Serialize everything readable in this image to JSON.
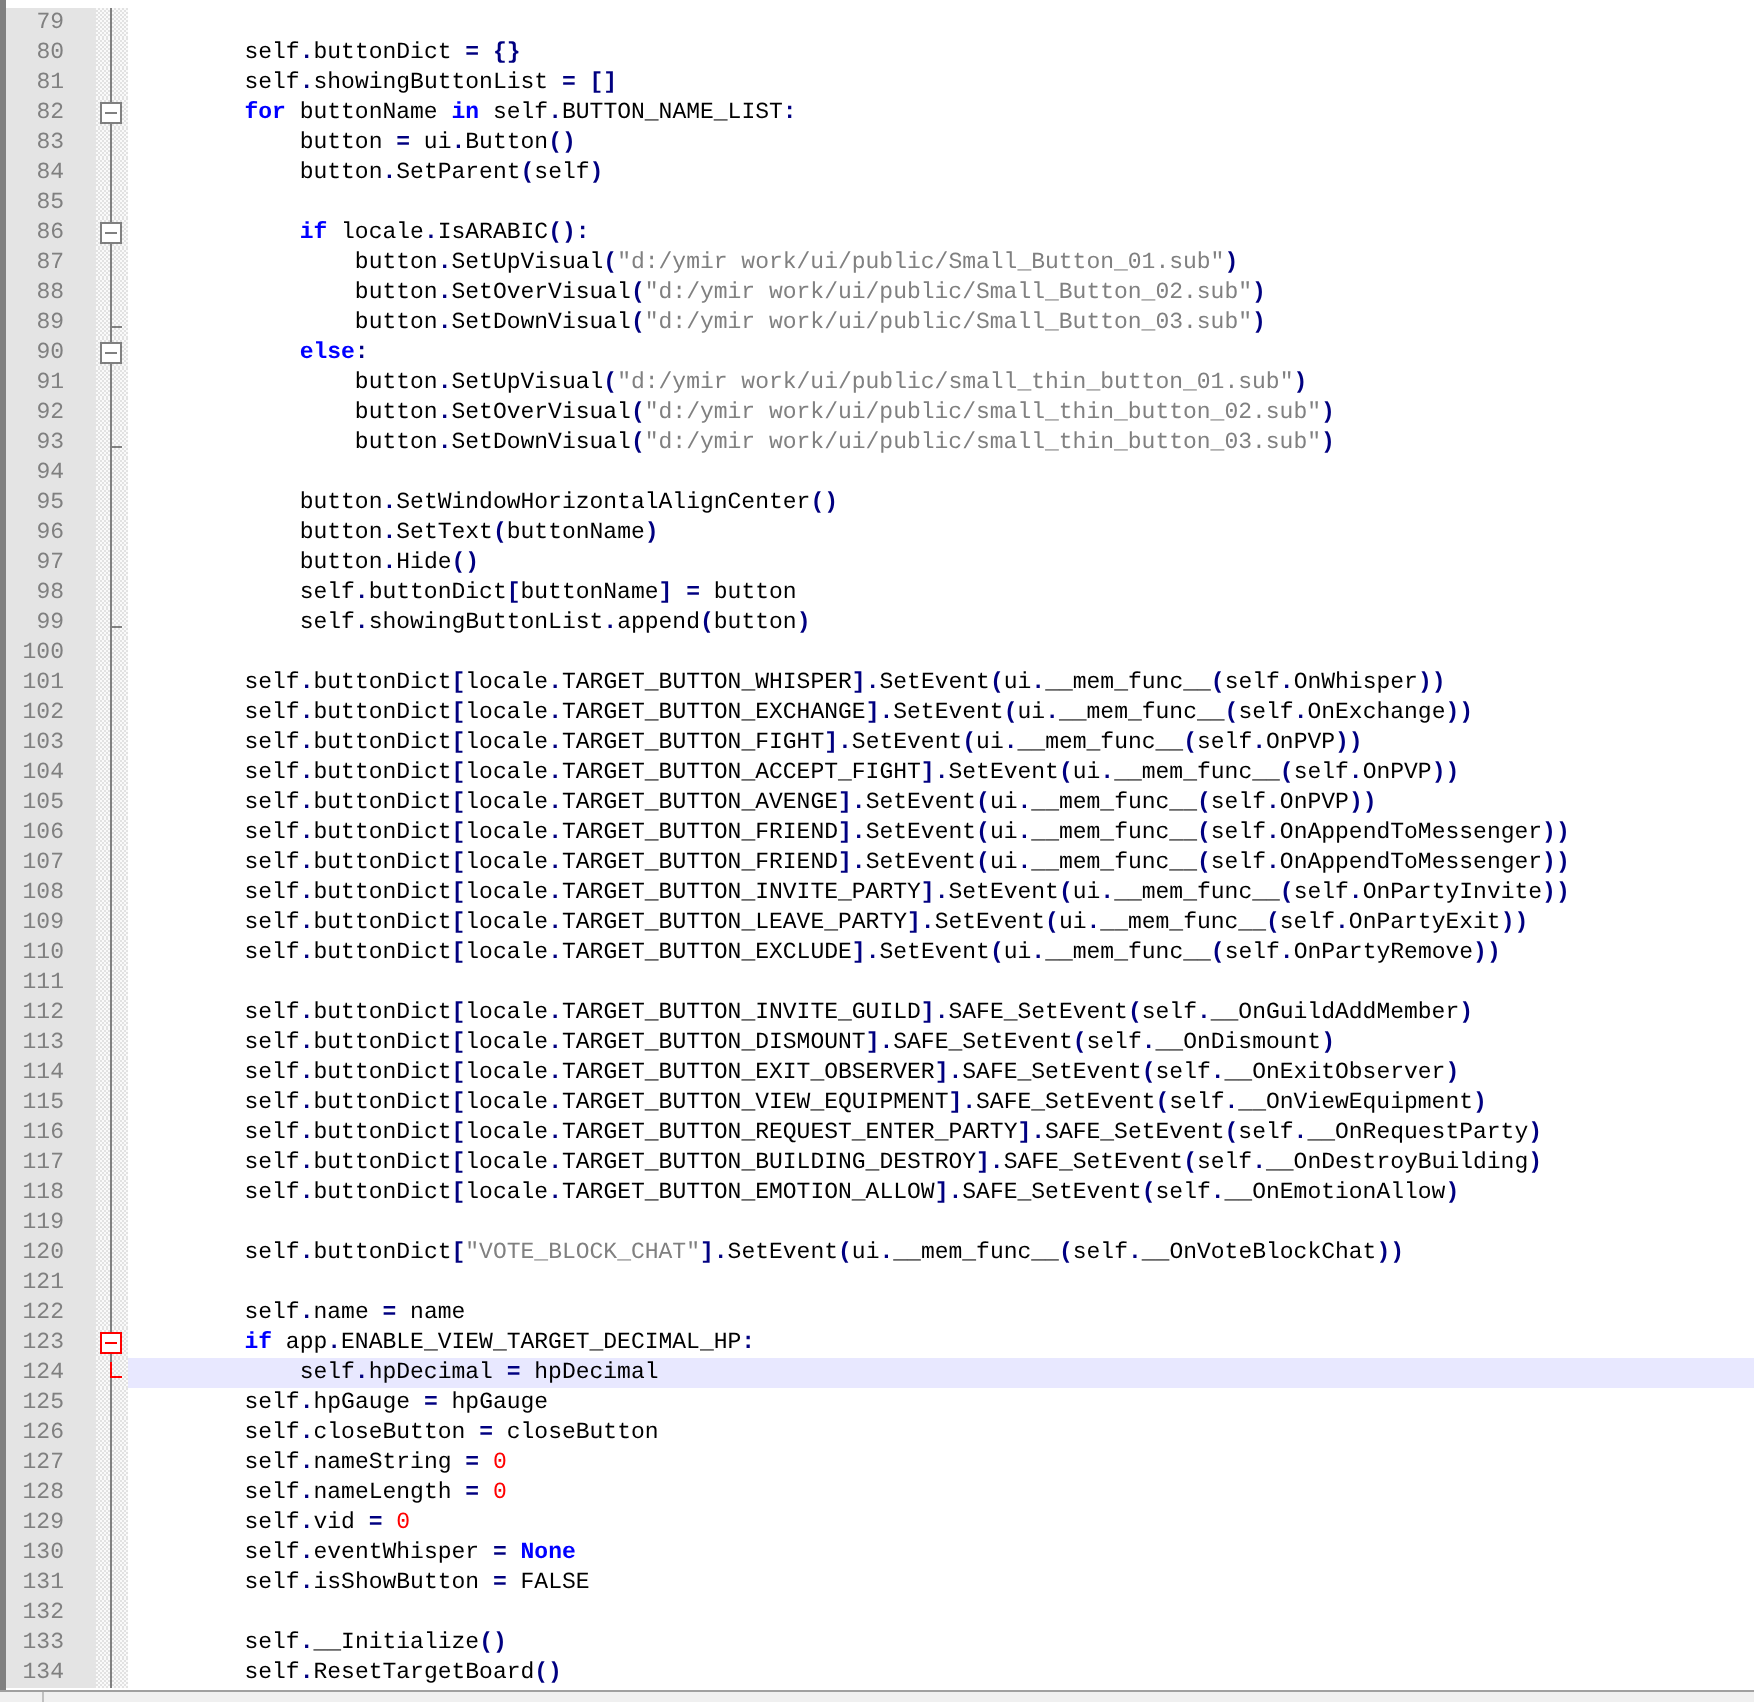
{
  "lines": [
    {
      "number": "79"
    },
    {
      "number": "80",
      "tokens": [
        {
          "text": "        self",
          "kind": "id"
        },
        {
          "text": ".",
          "kind": "op"
        },
        {
          "text": "buttonDict ",
          "kind": "id"
        },
        {
          "text": "= {}",
          "kind": "op"
        }
      ]
    },
    {
      "number": "81",
      "tokens": [
        {
          "text": "        self",
          "kind": "id"
        },
        {
          "text": ".",
          "kind": "op"
        },
        {
          "text": "showingButtonList ",
          "kind": "id"
        },
        {
          "text": "= []",
          "kind": "op"
        }
      ]
    },
    {
      "number": "82",
      "fold": {
        "kind": "start",
        "expanded": true,
        "active": false
      },
      "tokens": [
        {
          "text": "        for",
          "kind": "kw"
        },
        {
          "text": " buttonName ",
          "kind": "id"
        },
        {
          "text": "in",
          "kind": "kw"
        },
        {
          "text": " self",
          "kind": "id"
        },
        {
          "text": ".",
          "kind": "op"
        },
        {
          "text": "BUTTON_NAME_LIST",
          "kind": "id"
        },
        {
          "text": ":",
          "kind": "op"
        }
      ]
    },
    {
      "number": "83",
      "tokens": [
        {
          "text": "            button ",
          "kind": "id"
        },
        {
          "text": "=",
          "kind": "op"
        },
        {
          "text": " ui",
          "kind": "id"
        },
        {
          "text": ".",
          "kind": "op"
        },
        {
          "text": "Button",
          "kind": "id"
        },
        {
          "text": "()",
          "kind": "op"
        }
      ]
    },
    {
      "number": "84",
      "tokens": [
        {
          "text": "            button",
          "kind": "id"
        },
        {
          "text": ".",
          "kind": "op"
        },
        {
          "text": "SetParent",
          "kind": "id"
        },
        {
          "text": "(",
          "kind": "op"
        },
        {
          "text": "self",
          "kind": "id"
        },
        {
          "text": ")",
          "kind": "op"
        }
      ]
    },
    {
      "number": "85"
    },
    {
      "number": "86",
      "fold": {
        "kind": "start",
        "expanded": true,
        "active": false
      },
      "tokens": [
        {
          "text": "            if",
          "kind": "kw"
        },
        {
          "text": " locale",
          "kind": "id"
        },
        {
          "text": ".",
          "kind": "op"
        },
        {
          "text": "IsARABIC",
          "kind": "id"
        },
        {
          "text": "():",
          "kind": "op"
        }
      ]
    },
    {
      "number": "87",
      "tokens": [
        {
          "text": "                button",
          "kind": "id"
        },
        {
          "text": ".",
          "kind": "op"
        },
        {
          "text": "SetUpVisual",
          "kind": "id"
        },
        {
          "text": "(",
          "kind": "op"
        },
        {
          "text": "\"d:/ymir work/ui/public/Small_Button_01.sub\"",
          "kind": "str"
        },
        {
          "text": ")",
          "kind": "op"
        }
      ]
    },
    {
      "number": "88",
      "tokens": [
        {
          "text": "                button",
          "kind": "id"
        },
        {
          "text": ".",
          "kind": "op"
        },
        {
          "text": "SetOverVisual",
          "kind": "id"
        },
        {
          "text": "(",
          "kind": "op"
        },
        {
          "text": "\"d:/ymir work/ui/public/Small_Button_02.sub\"",
          "kind": "str"
        },
        {
          "text": ")",
          "kind": "op"
        }
      ]
    },
    {
      "number": "89",
      "fold": {
        "kind": "end",
        "active": false
      },
      "tokens": [
        {
          "text": "                button",
          "kind": "id"
        },
        {
          "text": ".",
          "kind": "op"
        },
        {
          "text": "SetDownVisual",
          "kind": "id"
        },
        {
          "text": "(",
          "kind": "op"
        },
        {
          "text": "\"d:/ymir work/ui/public/Small_Button_03.sub\"",
          "kind": "str"
        },
        {
          "text": ")",
          "kind": "op"
        }
      ]
    },
    {
      "number": "90",
      "fold": {
        "kind": "start",
        "expanded": true,
        "active": false
      },
      "tokens": [
        {
          "text": "            else",
          "kind": "kw"
        },
        {
          "text": ":",
          "kind": "op"
        }
      ]
    },
    {
      "number": "91",
      "tokens": [
        {
          "text": "                button",
          "kind": "id"
        },
        {
          "text": ".",
          "kind": "op"
        },
        {
          "text": "SetUpVisual",
          "kind": "id"
        },
        {
          "text": "(",
          "kind": "op"
        },
        {
          "text": "\"d:/ymir work/ui/public/small_thin_button_01.sub\"",
          "kind": "str"
        },
        {
          "text": ")",
          "kind": "op"
        }
      ]
    },
    {
      "number": "92",
      "tokens": [
        {
          "text": "                button",
          "kind": "id"
        },
        {
          "text": ".",
          "kind": "op"
        },
        {
          "text": "SetOverVisual",
          "kind": "id"
        },
        {
          "text": "(",
          "kind": "op"
        },
        {
          "text": "\"d:/ymir work/ui/public/small_thin_button_02.sub\"",
          "kind": "str"
        },
        {
          "text": ")",
          "kind": "op"
        }
      ]
    },
    {
      "number": "93",
      "fold": {
        "kind": "end",
        "active": false
      },
      "tokens": [
        {
          "text": "                button",
          "kind": "id"
        },
        {
          "text": ".",
          "kind": "op"
        },
        {
          "text": "SetDownVisual",
          "kind": "id"
        },
        {
          "text": "(",
          "kind": "op"
        },
        {
          "text": "\"d:/ymir work/ui/public/small_thin_button_03.sub\"",
          "kind": "str"
        },
        {
          "text": ")",
          "kind": "op"
        }
      ]
    },
    {
      "number": "94"
    },
    {
      "number": "95",
      "tokens": [
        {
          "text": "            button",
          "kind": "id"
        },
        {
          "text": ".",
          "kind": "op"
        },
        {
          "text": "SetWindowHorizontalAlignCenter",
          "kind": "id"
        },
        {
          "text": "()",
          "kind": "op"
        }
      ]
    },
    {
      "number": "96",
      "tokens": [
        {
          "text": "            button",
          "kind": "id"
        },
        {
          "text": ".",
          "kind": "op"
        },
        {
          "text": "SetText",
          "kind": "id"
        },
        {
          "text": "(",
          "kind": "op"
        },
        {
          "text": "buttonName",
          "kind": "id"
        },
        {
          "text": ")",
          "kind": "op"
        }
      ]
    },
    {
      "number": "97",
      "tokens": [
        {
          "text": "            button",
          "kind": "id"
        },
        {
          "text": ".",
          "kind": "op"
        },
        {
          "text": "Hide",
          "kind": "id"
        },
        {
          "text": "()",
          "kind": "op"
        }
      ]
    },
    {
      "number": "98",
      "tokens": [
        {
          "text": "            self",
          "kind": "id"
        },
        {
          "text": ".",
          "kind": "op"
        },
        {
          "text": "buttonDict",
          "kind": "id"
        },
        {
          "text": "[",
          "kind": "op"
        },
        {
          "text": "buttonName",
          "kind": "id"
        },
        {
          "text": "] =",
          "kind": "op"
        },
        {
          "text": " button",
          "kind": "id"
        }
      ]
    },
    {
      "number": "99",
      "fold": {
        "kind": "end",
        "active": false
      },
      "tokens": [
        {
          "text": "            self",
          "kind": "id"
        },
        {
          "text": ".",
          "kind": "op"
        },
        {
          "text": "showingButtonList",
          "kind": "id"
        },
        {
          "text": ".",
          "kind": "op"
        },
        {
          "text": "append",
          "kind": "id"
        },
        {
          "text": "(",
          "kind": "op"
        },
        {
          "text": "button",
          "kind": "id"
        },
        {
          "text": ")",
          "kind": "op"
        }
      ]
    },
    {
      "number": "100"
    },
    {
      "number": "101",
      "tokens": [
        {
          "text": "        self",
          "kind": "id"
        },
        {
          "text": ".",
          "kind": "op"
        },
        {
          "text": "buttonDict",
          "kind": "id"
        },
        {
          "text": "[",
          "kind": "op"
        },
        {
          "text": "locale",
          "kind": "id"
        },
        {
          "text": ".",
          "kind": "op"
        },
        {
          "text": "TARGET_BUTTON_WHISPER",
          "kind": "id"
        },
        {
          "text": "].",
          "kind": "op"
        },
        {
          "text": "SetEvent",
          "kind": "id"
        },
        {
          "text": "(",
          "kind": "op"
        },
        {
          "text": "ui",
          "kind": "id"
        },
        {
          "text": ".",
          "kind": "op"
        },
        {
          "text": "__mem_func__",
          "kind": "id"
        },
        {
          "text": "(",
          "kind": "op"
        },
        {
          "text": "self",
          "kind": "id"
        },
        {
          "text": ".",
          "kind": "op"
        },
        {
          "text": "OnWhisper",
          "kind": "id"
        },
        {
          "text": "))",
          "kind": "op"
        }
      ]
    },
    {
      "number": "102",
      "tokens": [
        {
          "text": "        self",
          "kind": "id"
        },
        {
          "text": ".",
          "kind": "op"
        },
        {
          "text": "buttonDict",
          "kind": "id"
        },
        {
          "text": "[",
          "kind": "op"
        },
        {
          "text": "locale",
          "kind": "id"
        },
        {
          "text": ".",
          "kind": "op"
        },
        {
          "text": "TARGET_BUTTON_EXCHANGE",
          "kind": "id"
        },
        {
          "text": "].",
          "kind": "op"
        },
        {
          "text": "SetEvent",
          "kind": "id"
        },
        {
          "text": "(",
          "kind": "op"
        },
        {
          "text": "ui",
          "kind": "id"
        },
        {
          "text": ".",
          "kind": "op"
        },
        {
          "text": "__mem_func__",
          "kind": "id"
        },
        {
          "text": "(",
          "kind": "op"
        },
        {
          "text": "self",
          "kind": "id"
        },
        {
          "text": ".",
          "kind": "op"
        },
        {
          "text": "OnExchange",
          "kind": "id"
        },
        {
          "text": "))",
          "kind": "op"
        }
      ]
    },
    {
      "number": "103",
      "tokens": [
        {
          "text": "        self",
          "kind": "id"
        },
        {
          "text": ".",
          "kind": "op"
        },
        {
          "text": "buttonDict",
          "kind": "id"
        },
        {
          "text": "[",
          "kind": "op"
        },
        {
          "text": "locale",
          "kind": "id"
        },
        {
          "text": ".",
          "kind": "op"
        },
        {
          "text": "TARGET_BUTTON_FIGHT",
          "kind": "id"
        },
        {
          "text": "].",
          "kind": "op"
        },
        {
          "text": "SetEvent",
          "kind": "id"
        },
        {
          "text": "(",
          "kind": "op"
        },
        {
          "text": "ui",
          "kind": "id"
        },
        {
          "text": ".",
          "kind": "op"
        },
        {
          "text": "__mem_func__",
          "kind": "id"
        },
        {
          "text": "(",
          "kind": "op"
        },
        {
          "text": "self",
          "kind": "id"
        },
        {
          "text": ".",
          "kind": "op"
        },
        {
          "text": "OnPVP",
          "kind": "id"
        },
        {
          "text": "))",
          "kind": "op"
        }
      ]
    },
    {
      "number": "104",
      "tokens": [
        {
          "text": "        self",
          "kind": "id"
        },
        {
          "text": ".",
          "kind": "op"
        },
        {
          "text": "buttonDict",
          "kind": "id"
        },
        {
          "text": "[",
          "kind": "op"
        },
        {
          "text": "locale",
          "kind": "id"
        },
        {
          "text": ".",
          "kind": "op"
        },
        {
          "text": "TARGET_BUTTON_ACCEPT_FIGHT",
          "kind": "id"
        },
        {
          "text": "].",
          "kind": "op"
        },
        {
          "text": "SetEvent",
          "kind": "id"
        },
        {
          "text": "(",
          "kind": "op"
        },
        {
          "text": "ui",
          "kind": "id"
        },
        {
          "text": ".",
          "kind": "op"
        },
        {
          "text": "__mem_func__",
          "kind": "id"
        },
        {
          "text": "(",
          "kind": "op"
        },
        {
          "text": "self",
          "kind": "id"
        },
        {
          "text": ".",
          "kind": "op"
        },
        {
          "text": "OnPVP",
          "kind": "id"
        },
        {
          "text": "))",
          "kind": "op"
        }
      ]
    },
    {
      "number": "105",
      "tokens": [
        {
          "text": "        self",
          "kind": "id"
        },
        {
          "text": ".",
          "kind": "op"
        },
        {
          "text": "buttonDict",
          "kind": "id"
        },
        {
          "text": "[",
          "kind": "op"
        },
        {
          "text": "locale",
          "kind": "id"
        },
        {
          "text": ".",
          "kind": "op"
        },
        {
          "text": "TARGET_BUTTON_AVENGE",
          "kind": "id"
        },
        {
          "text": "].",
          "kind": "op"
        },
        {
          "text": "SetEvent",
          "kind": "id"
        },
        {
          "text": "(",
          "kind": "op"
        },
        {
          "text": "ui",
          "kind": "id"
        },
        {
          "text": ".",
          "kind": "op"
        },
        {
          "text": "__mem_func__",
          "kind": "id"
        },
        {
          "text": "(",
          "kind": "op"
        },
        {
          "text": "self",
          "kind": "id"
        },
        {
          "text": ".",
          "kind": "op"
        },
        {
          "text": "OnPVP",
          "kind": "id"
        },
        {
          "text": "))",
          "kind": "op"
        }
      ]
    },
    {
      "number": "106",
      "tokens": [
        {
          "text": "        self",
          "kind": "id"
        },
        {
          "text": ".",
          "kind": "op"
        },
        {
          "text": "buttonDict",
          "kind": "id"
        },
        {
          "text": "[",
          "kind": "op"
        },
        {
          "text": "locale",
          "kind": "id"
        },
        {
          "text": ".",
          "kind": "op"
        },
        {
          "text": "TARGET_BUTTON_FRIEND",
          "kind": "id"
        },
        {
          "text": "].",
          "kind": "op"
        },
        {
          "text": "SetEvent",
          "kind": "id"
        },
        {
          "text": "(",
          "kind": "op"
        },
        {
          "text": "ui",
          "kind": "id"
        },
        {
          "text": ".",
          "kind": "op"
        },
        {
          "text": "__mem_func__",
          "kind": "id"
        },
        {
          "text": "(",
          "kind": "op"
        },
        {
          "text": "self",
          "kind": "id"
        },
        {
          "text": ".",
          "kind": "op"
        },
        {
          "text": "OnAppendToMessenger",
          "kind": "id"
        },
        {
          "text": "))",
          "kind": "op"
        }
      ]
    },
    {
      "number": "107",
      "tokens": [
        {
          "text": "        self",
          "kind": "id"
        },
        {
          "text": ".",
          "kind": "op"
        },
        {
          "text": "buttonDict",
          "kind": "id"
        },
        {
          "text": "[",
          "kind": "op"
        },
        {
          "text": "locale",
          "kind": "id"
        },
        {
          "text": ".",
          "kind": "op"
        },
        {
          "text": "TARGET_BUTTON_FRIEND",
          "kind": "id"
        },
        {
          "text": "].",
          "kind": "op"
        },
        {
          "text": "SetEvent",
          "kind": "id"
        },
        {
          "text": "(",
          "kind": "op"
        },
        {
          "text": "ui",
          "kind": "id"
        },
        {
          "text": ".",
          "kind": "op"
        },
        {
          "text": "__mem_func__",
          "kind": "id"
        },
        {
          "text": "(",
          "kind": "op"
        },
        {
          "text": "self",
          "kind": "id"
        },
        {
          "text": ".",
          "kind": "op"
        },
        {
          "text": "OnAppendToMessenger",
          "kind": "id"
        },
        {
          "text": "))",
          "kind": "op"
        }
      ]
    },
    {
      "number": "108",
      "tokens": [
        {
          "text": "        self",
          "kind": "id"
        },
        {
          "text": ".",
          "kind": "op"
        },
        {
          "text": "buttonDict",
          "kind": "id"
        },
        {
          "text": "[",
          "kind": "op"
        },
        {
          "text": "locale",
          "kind": "id"
        },
        {
          "text": ".",
          "kind": "op"
        },
        {
          "text": "TARGET_BUTTON_INVITE_PARTY",
          "kind": "id"
        },
        {
          "text": "].",
          "kind": "op"
        },
        {
          "text": "SetEvent",
          "kind": "id"
        },
        {
          "text": "(",
          "kind": "op"
        },
        {
          "text": "ui",
          "kind": "id"
        },
        {
          "text": ".",
          "kind": "op"
        },
        {
          "text": "__mem_func__",
          "kind": "id"
        },
        {
          "text": "(",
          "kind": "op"
        },
        {
          "text": "self",
          "kind": "id"
        },
        {
          "text": ".",
          "kind": "op"
        },
        {
          "text": "OnPartyInvite",
          "kind": "id"
        },
        {
          "text": "))",
          "kind": "op"
        }
      ]
    },
    {
      "number": "109",
      "tokens": [
        {
          "text": "        self",
          "kind": "id"
        },
        {
          "text": ".",
          "kind": "op"
        },
        {
          "text": "buttonDict",
          "kind": "id"
        },
        {
          "text": "[",
          "kind": "op"
        },
        {
          "text": "locale",
          "kind": "id"
        },
        {
          "text": ".",
          "kind": "op"
        },
        {
          "text": "TARGET_BUTTON_LEAVE_PARTY",
          "kind": "id"
        },
        {
          "text": "].",
          "kind": "op"
        },
        {
          "text": "SetEvent",
          "kind": "id"
        },
        {
          "text": "(",
          "kind": "op"
        },
        {
          "text": "ui",
          "kind": "id"
        },
        {
          "text": ".",
          "kind": "op"
        },
        {
          "text": "__mem_func__",
          "kind": "id"
        },
        {
          "text": "(",
          "kind": "op"
        },
        {
          "text": "self",
          "kind": "id"
        },
        {
          "text": ".",
          "kind": "op"
        },
        {
          "text": "OnPartyExit",
          "kind": "id"
        },
        {
          "text": "))",
          "kind": "op"
        }
      ]
    },
    {
      "number": "110",
      "tokens": [
        {
          "text": "        self",
          "kind": "id"
        },
        {
          "text": ".",
          "kind": "op"
        },
        {
          "text": "buttonDict",
          "kind": "id"
        },
        {
          "text": "[",
          "kind": "op"
        },
        {
          "text": "locale",
          "kind": "id"
        },
        {
          "text": ".",
          "kind": "op"
        },
        {
          "text": "TARGET_BUTTON_EXCLUDE",
          "kind": "id"
        },
        {
          "text": "].",
          "kind": "op"
        },
        {
          "text": "SetEvent",
          "kind": "id"
        },
        {
          "text": "(",
          "kind": "op"
        },
        {
          "text": "ui",
          "kind": "id"
        },
        {
          "text": ".",
          "kind": "op"
        },
        {
          "text": "__mem_func__",
          "kind": "id"
        },
        {
          "text": "(",
          "kind": "op"
        },
        {
          "text": "self",
          "kind": "id"
        },
        {
          "text": ".",
          "kind": "op"
        },
        {
          "text": "OnPartyRemove",
          "kind": "id"
        },
        {
          "text": "))",
          "kind": "op"
        }
      ]
    },
    {
      "number": "111"
    },
    {
      "number": "112",
      "tokens": [
        {
          "text": "        self",
          "kind": "id"
        },
        {
          "text": ".",
          "kind": "op"
        },
        {
          "text": "buttonDict",
          "kind": "id"
        },
        {
          "text": "[",
          "kind": "op"
        },
        {
          "text": "locale",
          "kind": "id"
        },
        {
          "text": ".",
          "kind": "op"
        },
        {
          "text": "TARGET_BUTTON_INVITE_GUILD",
          "kind": "id"
        },
        {
          "text": "].",
          "kind": "op"
        },
        {
          "text": "SAFE_SetEvent",
          "kind": "id"
        },
        {
          "text": "(",
          "kind": "op"
        },
        {
          "text": "self",
          "kind": "id"
        },
        {
          "text": ".",
          "kind": "op"
        },
        {
          "text": "__OnGuildAddMember",
          "kind": "id"
        },
        {
          "text": ")",
          "kind": "op"
        }
      ]
    },
    {
      "number": "113",
      "tokens": [
        {
          "text": "        self",
          "kind": "id"
        },
        {
          "text": ".",
          "kind": "op"
        },
        {
          "text": "buttonDict",
          "kind": "id"
        },
        {
          "text": "[",
          "kind": "op"
        },
        {
          "text": "locale",
          "kind": "id"
        },
        {
          "text": ".",
          "kind": "op"
        },
        {
          "text": "TARGET_BUTTON_DISMOUNT",
          "kind": "id"
        },
        {
          "text": "].",
          "kind": "op"
        },
        {
          "text": "SAFE_SetEvent",
          "kind": "id"
        },
        {
          "text": "(",
          "kind": "op"
        },
        {
          "text": "self",
          "kind": "id"
        },
        {
          "text": ".",
          "kind": "op"
        },
        {
          "text": "__OnDismount",
          "kind": "id"
        },
        {
          "text": ")",
          "kind": "op"
        }
      ]
    },
    {
      "number": "114",
      "tokens": [
        {
          "text": "        self",
          "kind": "id"
        },
        {
          "text": ".",
          "kind": "op"
        },
        {
          "text": "buttonDict",
          "kind": "id"
        },
        {
          "text": "[",
          "kind": "op"
        },
        {
          "text": "locale",
          "kind": "id"
        },
        {
          "text": ".",
          "kind": "op"
        },
        {
          "text": "TARGET_BUTTON_EXIT_OBSERVER",
          "kind": "id"
        },
        {
          "text": "].",
          "kind": "op"
        },
        {
          "text": "SAFE_SetEvent",
          "kind": "id"
        },
        {
          "text": "(",
          "kind": "op"
        },
        {
          "text": "self",
          "kind": "id"
        },
        {
          "text": ".",
          "kind": "op"
        },
        {
          "text": "__OnExitObserver",
          "kind": "id"
        },
        {
          "text": ")",
          "kind": "op"
        }
      ]
    },
    {
      "number": "115",
      "tokens": [
        {
          "text": "        self",
          "kind": "id"
        },
        {
          "text": ".",
          "kind": "op"
        },
        {
          "text": "buttonDict",
          "kind": "id"
        },
        {
          "text": "[",
          "kind": "op"
        },
        {
          "text": "locale",
          "kind": "id"
        },
        {
          "text": ".",
          "kind": "op"
        },
        {
          "text": "TARGET_BUTTON_VIEW_EQUIPMENT",
          "kind": "id"
        },
        {
          "text": "].",
          "kind": "op"
        },
        {
          "text": "SAFE_SetEvent",
          "kind": "id"
        },
        {
          "text": "(",
          "kind": "op"
        },
        {
          "text": "self",
          "kind": "id"
        },
        {
          "text": ".",
          "kind": "op"
        },
        {
          "text": "__OnViewEquipment",
          "kind": "id"
        },
        {
          "text": ")",
          "kind": "op"
        }
      ]
    },
    {
      "number": "116",
      "tokens": [
        {
          "text": "        self",
          "kind": "id"
        },
        {
          "text": ".",
          "kind": "op"
        },
        {
          "text": "buttonDict",
          "kind": "id"
        },
        {
          "text": "[",
          "kind": "op"
        },
        {
          "text": "locale",
          "kind": "id"
        },
        {
          "text": ".",
          "kind": "op"
        },
        {
          "text": "TARGET_BUTTON_REQUEST_ENTER_PARTY",
          "kind": "id"
        },
        {
          "text": "].",
          "kind": "op"
        },
        {
          "text": "SAFE_SetEvent",
          "kind": "id"
        },
        {
          "text": "(",
          "kind": "op"
        },
        {
          "text": "self",
          "kind": "id"
        },
        {
          "text": ".",
          "kind": "op"
        },
        {
          "text": "__OnRequestParty",
          "kind": "id"
        },
        {
          "text": ")",
          "kind": "op"
        }
      ]
    },
    {
      "number": "117",
      "tokens": [
        {
          "text": "        self",
          "kind": "id"
        },
        {
          "text": ".",
          "kind": "op"
        },
        {
          "text": "buttonDict",
          "kind": "id"
        },
        {
          "text": "[",
          "kind": "op"
        },
        {
          "text": "locale",
          "kind": "id"
        },
        {
          "text": ".",
          "kind": "op"
        },
        {
          "text": "TARGET_BUTTON_BUILDING_DESTROY",
          "kind": "id"
        },
        {
          "text": "].",
          "kind": "op"
        },
        {
          "text": "SAFE_SetEvent",
          "kind": "id"
        },
        {
          "text": "(",
          "kind": "op"
        },
        {
          "text": "self",
          "kind": "id"
        },
        {
          "text": ".",
          "kind": "op"
        },
        {
          "text": "__OnDestroyBuilding",
          "kind": "id"
        },
        {
          "text": ")",
          "kind": "op"
        }
      ]
    },
    {
      "number": "118",
      "tokens": [
        {
          "text": "        self",
          "kind": "id"
        },
        {
          "text": ".",
          "kind": "op"
        },
        {
          "text": "buttonDict",
          "kind": "id"
        },
        {
          "text": "[",
          "kind": "op"
        },
        {
          "text": "locale",
          "kind": "id"
        },
        {
          "text": ".",
          "kind": "op"
        },
        {
          "text": "TARGET_BUTTON_EMOTION_ALLOW",
          "kind": "id"
        },
        {
          "text": "].",
          "kind": "op"
        },
        {
          "text": "SAFE_SetEvent",
          "kind": "id"
        },
        {
          "text": "(",
          "kind": "op"
        },
        {
          "text": "self",
          "kind": "id"
        },
        {
          "text": ".",
          "kind": "op"
        },
        {
          "text": "__OnEmotionAllow",
          "kind": "id"
        },
        {
          "text": ")",
          "kind": "op"
        }
      ]
    },
    {
      "number": "119"
    },
    {
      "number": "120",
      "tokens": [
        {
          "text": "        self",
          "kind": "id"
        },
        {
          "text": ".",
          "kind": "op"
        },
        {
          "text": "buttonDict",
          "kind": "id"
        },
        {
          "text": "[",
          "kind": "op"
        },
        {
          "text": "\"VOTE_BLOCK_CHAT\"",
          "kind": "str"
        },
        {
          "text": "].",
          "kind": "op"
        },
        {
          "text": "SetEvent",
          "kind": "id"
        },
        {
          "text": "(",
          "kind": "op"
        },
        {
          "text": "ui",
          "kind": "id"
        },
        {
          "text": ".",
          "kind": "op"
        },
        {
          "text": "__mem_func__",
          "kind": "id"
        },
        {
          "text": "(",
          "kind": "op"
        },
        {
          "text": "self",
          "kind": "id"
        },
        {
          "text": ".",
          "kind": "op"
        },
        {
          "text": "__OnVoteBlockChat",
          "kind": "id"
        },
        {
          "text": "))",
          "kind": "op"
        }
      ]
    },
    {
      "number": "121"
    },
    {
      "number": "122",
      "tokens": [
        {
          "text": "        self",
          "kind": "id"
        },
        {
          "text": ".",
          "kind": "op"
        },
        {
          "text": "name ",
          "kind": "id"
        },
        {
          "text": "=",
          "kind": "op"
        },
        {
          "text": " name",
          "kind": "id"
        }
      ]
    },
    {
      "number": "123",
      "fold": {
        "kind": "start",
        "expanded": true,
        "active": true
      },
      "tokens": [
        {
          "text": "        if",
          "kind": "kw"
        },
        {
          "text": " app",
          "kind": "id"
        },
        {
          "text": ".",
          "kind": "op"
        },
        {
          "text": "ENABLE_VIEW_TARGET_DECIMAL_HP",
          "kind": "id"
        },
        {
          "text": ":",
          "kind": "op"
        }
      ]
    },
    {
      "number": "124",
      "current": true,
      "fold": {
        "kind": "end",
        "active": true
      },
      "tokens": [
        {
          "text": "            self",
          "kind": "id"
        },
        {
          "text": ".",
          "kind": "op"
        },
        {
          "text": "hpDecimal ",
          "kind": "id"
        },
        {
          "text": "=",
          "kind": "op"
        },
        {
          "text": " hpDecimal",
          "kind": "id"
        }
      ]
    },
    {
      "number": "125",
      "tokens": [
        {
          "text": "        self",
          "kind": "id"
        },
        {
          "text": ".",
          "kind": "op"
        },
        {
          "text": "hpGauge ",
          "kind": "id"
        },
        {
          "text": "=",
          "kind": "op"
        },
        {
          "text": " hpGauge",
          "kind": "id"
        }
      ]
    },
    {
      "number": "126",
      "tokens": [
        {
          "text": "        self",
          "kind": "id"
        },
        {
          "text": ".",
          "kind": "op"
        },
        {
          "text": "closeButton ",
          "kind": "id"
        },
        {
          "text": "=",
          "kind": "op"
        },
        {
          "text": " closeButton",
          "kind": "id"
        }
      ]
    },
    {
      "number": "127",
      "tokens": [
        {
          "text": "        self",
          "kind": "id"
        },
        {
          "text": ".",
          "kind": "op"
        },
        {
          "text": "nameString ",
          "kind": "id"
        },
        {
          "text": "=",
          "kind": "op"
        },
        {
          "text": " 0",
          "kind": "num"
        }
      ]
    },
    {
      "number": "128",
      "tokens": [
        {
          "text": "        self",
          "kind": "id"
        },
        {
          "text": ".",
          "kind": "op"
        },
        {
          "text": "nameLength ",
          "kind": "id"
        },
        {
          "text": "=",
          "kind": "op"
        },
        {
          "text": " 0",
          "kind": "num"
        }
      ]
    },
    {
      "number": "129",
      "tokens": [
        {
          "text": "        self",
          "kind": "id"
        },
        {
          "text": ".",
          "kind": "op"
        },
        {
          "text": "vid ",
          "kind": "id"
        },
        {
          "text": "=",
          "kind": "op"
        },
        {
          "text": " 0",
          "kind": "num"
        }
      ]
    },
    {
      "number": "130",
      "tokens": [
        {
          "text": "        self",
          "kind": "id"
        },
        {
          "text": ".",
          "kind": "op"
        },
        {
          "text": "eventWhisper ",
          "kind": "id"
        },
        {
          "text": "=",
          "kind": "op"
        },
        {
          "text": " None",
          "kind": "kw"
        }
      ]
    },
    {
      "number": "131",
      "tokens": [
        {
          "text": "        self",
          "kind": "id"
        },
        {
          "text": ".",
          "kind": "op"
        },
        {
          "text": "isShowButton ",
          "kind": "id"
        },
        {
          "text": "=",
          "kind": "op"
        },
        {
          "text": " FALSE",
          "kind": "id"
        }
      ]
    },
    {
      "number": "132"
    },
    {
      "number": "133",
      "tokens": [
        {
          "text": "        self",
          "kind": "id"
        },
        {
          "text": ".",
          "kind": "op"
        },
        {
          "text": "__Initialize",
          "kind": "id"
        },
        {
          "text": "()",
          "kind": "op"
        }
      ]
    },
    {
      "number": "134",
      "tokens": [
        {
          "text": "        self",
          "kind": "id"
        },
        {
          "text": ".",
          "kind": "op"
        },
        {
          "text": "ResetTargetBoard",
          "kind": "id"
        },
        {
          "text": "()",
          "kind": "op"
        }
      ]
    }
  ]
}
